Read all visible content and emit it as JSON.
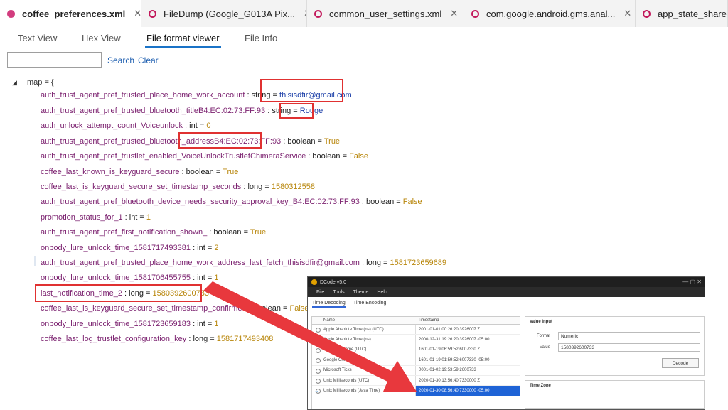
{
  "tabs": [
    {
      "label": "coffee_preferences.xml",
      "close": "✕"
    },
    {
      "label": "FileDump (Google_G013A Pix...",
      "close": "✕"
    },
    {
      "label": "common_user_settings.xml",
      "close": "✕"
    },
    {
      "label": "com.google.android.gms.anal...",
      "close": "✕"
    },
    {
      "label": "app_state_shared_",
      "close": ""
    }
  ],
  "view_tabs": [
    "Text View",
    "Hex View",
    "File format viewer",
    "File Info"
  ],
  "search": {
    "placeholder": "",
    "search_label": "Search",
    "clear_label": "Clear"
  },
  "tree": {
    "toggle": "◢",
    "root": "map = {",
    "entries": [
      {
        "key": "auth_trust_agent_pref_trusted_place_home_work_account",
        "type": " : string = ",
        "value": "thisisdfir@gmail.com",
        "kind": "s"
      },
      {
        "key": "auth_trust_agent_pref_trusted_bluetooth_titleB4:EC:02:73:FF:93",
        "type": " : string = ",
        "value": "Rouge",
        "kind": "s"
      },
      {
        "key": "auth_unlock_attempt_count_Voiceunlock",
        "type": " : int = ",
        "value": "0",
        "kind": "v"
      },
      {
        "key": "auth_trust_agent_pref_trusted_bluetooth_addressB4:EC:02:73:FF:93",
        "type": " : boolean = ",
        "value": "True",
        "kind": "v"
      },
      {
        "key": "auth_trust_agent_pref_trustlet_enabled_VoiceUnlockTrustletChimeraService",
        "type": " : boolean = ",
        "value": "False",
        "kind": "v"
      },
      {
        "key": "coffee_last_known_is_keyguard_secure",
        "type": " : boolean = ",
        "value": "True",
        "kind": "v"
      },
      {
        "key": "coffee_last_is_keyguard_secure_set_timestamp_seconds",
        "type": " : long = ",
        "value": "1580312558",
        "kind": "v"
      },
      {
        "key": "auth_trust_agent_pref_bluetooth_device_needs_security_approval_key_B4:EC:02:73:FF:93",
        "type": " : boolean = ",
        "value": "False",
        "kind": "v"
      },
      {
        "key": "promotion_status_for_1",
        "type": " : int = ",
        "value": "1",
        "kind": "v"
      },
      {
        "key": "auth_trust_agent_pref_first_notification_shown_",
        "type": " : boolean = ",
        "value": "True",
        "kind": "v"
      },
      {
        "key": "onbody_lure_unlock_time_1581717493381",
        "type": " : int = ",
        "value": "2",
        "kind": "v"
      },
      {
        "key": "auth_trust_agent_pref_trusted_place_home_work_address_last_fetch_thisisdfir@gmail.com",
        "type": " : long = ",
        "value": "1581723659689",
        "kind": "v"
      },
      {
        "key": "onbody_lure_unlock_time_1581706455755",
        "type": " : int = ",
        "value": "1",
        "kind": "v"
      },
      {
        "key": "last_notification_time_2",
        "type": " : long = ",
        "value": "1580392600733",
        "kind": "v"
      },
      {
        "key": "coffee_last_is_keyguard_secure_set_timestamp_confirmed",
        "type": " : boolean = ",
        "value": "False",
        "kind": "v"
      },
      {
        "key": "onbody_lure_unlock_time_1581723659183",
        "type": " : int = ",
        "value": "1",
        "kind": "v"
      },
      {
        "key": "coffee_last_log_trustlet_configuration_key",
        "type": " : long = ",
        "value": "1581717493408",
        "kind": "v"
      }
    ]
  },
  "dcode": {
    "title": "DCode v5.0",
    "controls": "—  ▢  ✕",
    "menu": [
      "File",
      "Tools",
      "Theme",
      "Help"
    ],
    "tabs": [
      "Time Decoding",
      "Time Encoding"
    ],
    "columns": [
      "Name",
      "Timestamp"
    ],
    "rows": [
      {
        "name": "Apple Absolute Time (ns) (UTC)",
        "ts": "2001-01-01 00:26:20.3926007 Z"
      },
      {
        "name": "Apple Absolute Time (ns)",
        "ts": "2000-12-31 19:26:20.3926007 -05:00"
      },
      {
        "name": "Google Chrome (UTC)",
        "ts": "1601-01-19 06:59:52.6007330 Z"
      },
      {
        "name": "Google Chrome",
        "ts": "1601-01-19 01:59:52.6007330 -05:00"
      },
      {
        "name": "Microsoft Ticks",
        "ts": "0001-01-02 19:53:59.2600733"
      },
      {
        "name": "Unix Milliseconds (UTC)",
        "ts": "2020-01-30 13:56:40.7330000 Z"
      },
      {
        "name": "Unix Milliseconds (Java Time)",
        "ts": "2020-01-30 08:56:40.7330000 -05:00"
      }
    ],
    "value_input_label": "Value Input",
    "format_label": "Format",
    "format_value": "Numeric",
    "value_label": "Value",
    "value_value": "1580392600733",
    "decode_label": "Decode",
    "timezone_label": "Time Zone",
    "arrow_glyph": "→"
  },
  "colors": {
    "highlight": "#e03131",
    "arrow": "#e8383d",
    "accent": "#1a73c7"
  }
}
